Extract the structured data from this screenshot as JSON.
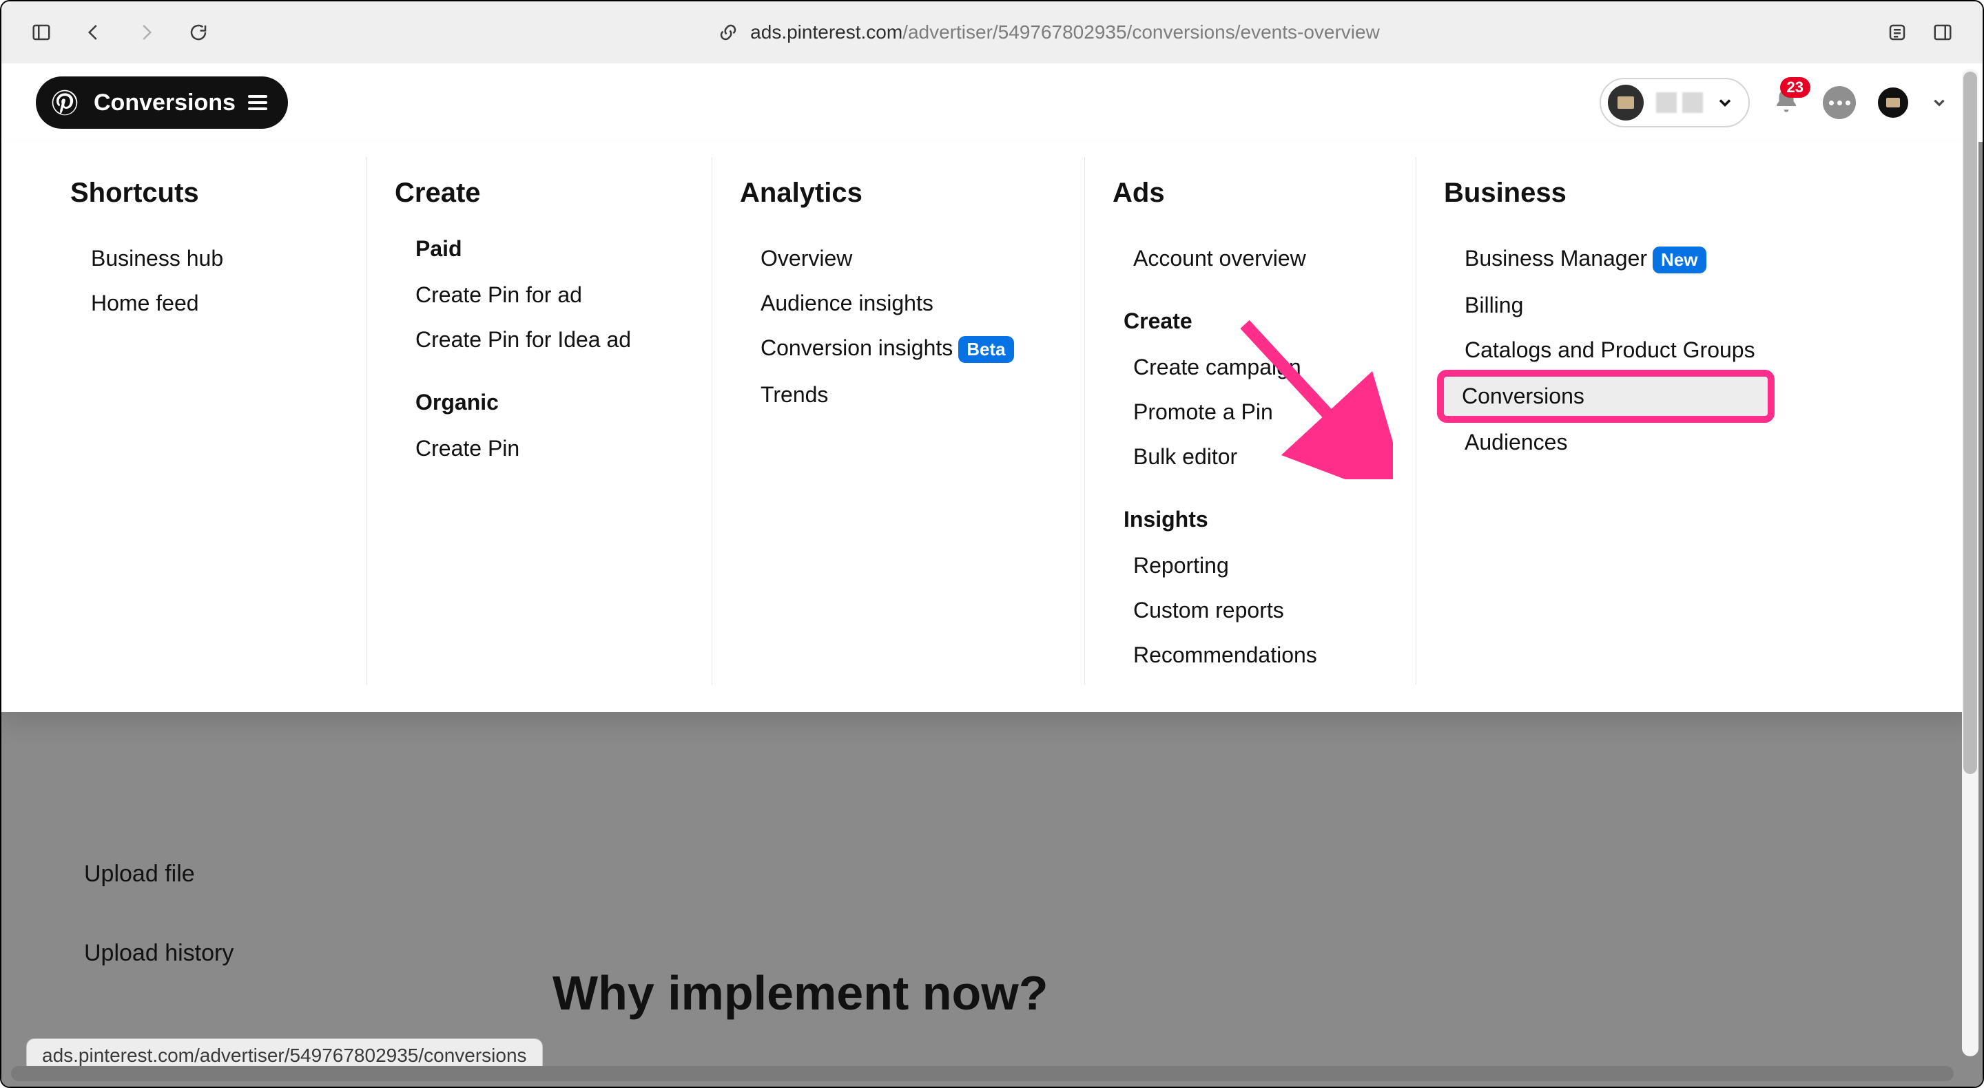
{
  "browser": {
    "url_host": "ads.pinterest.com",
    "url_path": "/advertiser/549767802935/conversions/events-overview"
  },
  "header": {
    "pill_label": "Conversions",
    "notification_count": "23"
  },
  "mega_menu": {
    "shortcuts": {
      "title": "Shortcuts",
      "items": [
        "Business hub",
        "Home feed"
      ]
    },
    "create": {
      "title": "Create",
      "paid_label": "Paid",
      "paid_items": [
        "Create Pin for ad",
        "Create Pin for Idea ad"
      ],
      "organic_label": "Organic",
      "organic_items": [
        "Create Pin"
      ]
    },
    "analytics": {
      "title": "Analytics",
      "items": [
        {
          "label": "Overview",
          "badge": ""
        },
        {
          "label": "Audience insights",
          "badge": ""
        },
        {
          "label": "Conversion insights",
          "badge": "Beta"
        },
        {
          "label": "Trends",
          "badge": ""
        }
      ]
    },
    "ads": {
      "title": "Ads",
      "top_items": [
        "Account overview"
      ],
      "create_label": "Create",
      "create_items": [
        "Create campaign",
        "Promote a Pin",
        "Bulk editor"
      ],
      "insights_label": "Insights",
      "insights_items": [
        "Reporting",
        "Custom reports",
        "Recommendations"
      ]
    },
    "business": {
      "title": "Business",
      "items": [
        {
          "label": "Business Manager",
          "badge": "New",
          "highlight": false
        },
        {
          "label": "Billing",
          "badge": "",
          "highlight": false
        },
        {
          "label": "Catalogs and Product Groups",
          "badge": "",
          "highlight": false
        },
        {
          "label": "Conversions",
          "badge": "",
          "highlight": true
        },
        {
          "label": "Audiences",
          "badge": "",
          "highlight": false
        }
      ]
    }
  },
  "background": {
    "sidebar_items": [
      "Upload file",
      "Upload history"
    ],
    "heading": "Why implement now?"
  },
  "status_url": "ads.pinterest.com/advertiser/549767802935/conversions"
}
